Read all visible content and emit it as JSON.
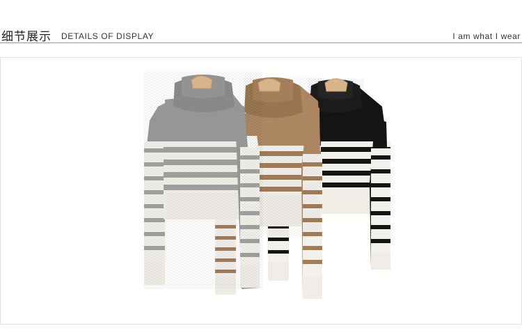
{
  "header": {
    "title_cn": "细节展示",
    "title_en": "DETAILS OF DISPLAY",
    "tagline": "I am what I wear"
  },
  "photo": {
    "subject": "three striped turtleneck sweaters on wooden hangers",
    "colors": {
      "grey": "#9a9a9a",
      "tan": "#b08a63",
      "black": "#141414",
      "cream": "#f3f1ec",
      "hanger": "#d9b48a"
    }
  }
}
